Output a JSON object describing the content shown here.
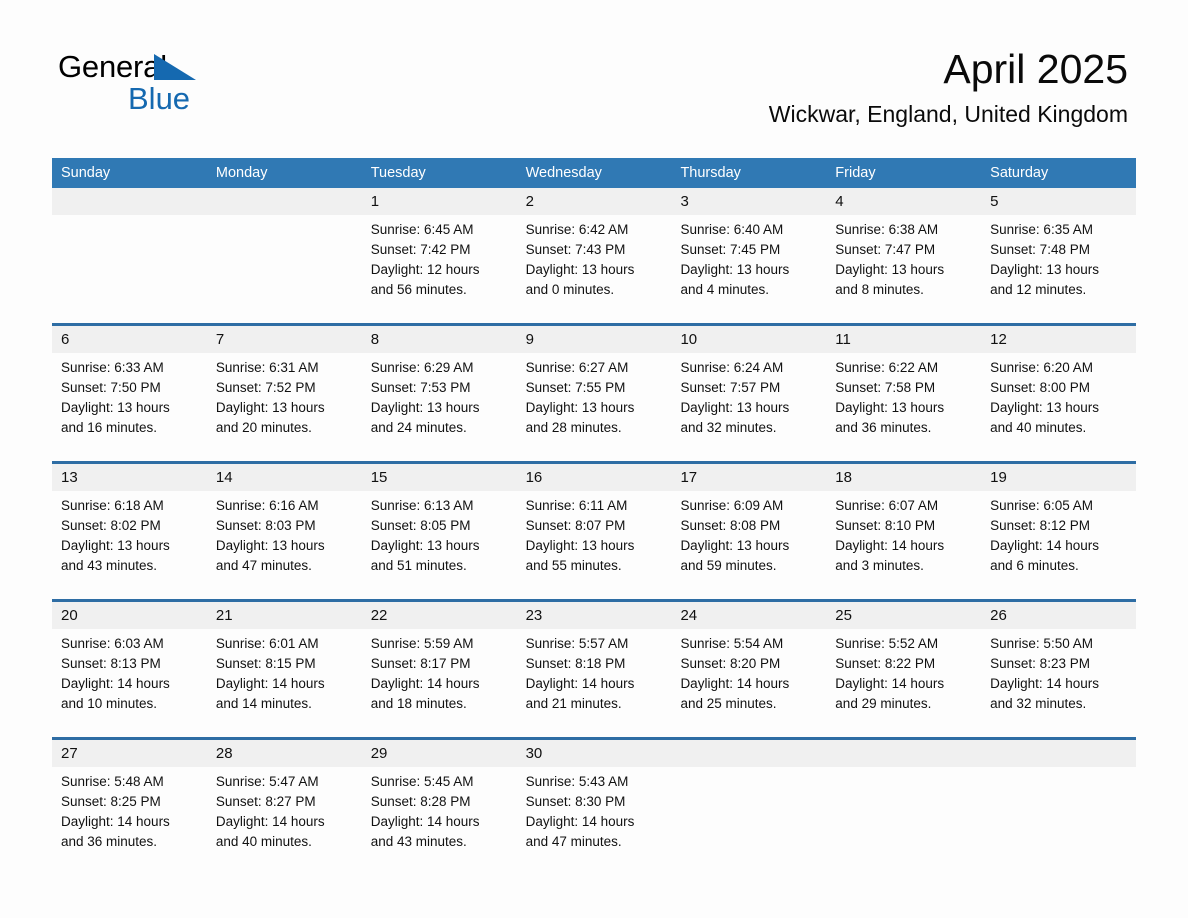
{
  "brand": {
    "name_part1": "General",
    "name_part2": "Blue",
    "primary_color": "#1569b0"
  },
  "header": {
    "title": "April 2025",
    "location": "Wickwar, England, United Kingdom"
  },
  "calendar": {
    "header_color": "#3079b4",
    "row_divider_color": "#2e6da4",
    "daynum_band_color": "#f0f0f0",
    "weekdays": [
      "Sunday",
      "Monday",
      "Tuesday",
      "Wednesday",
      "Thursday",
      "Friday",
      "Saturday"
    ],
    "weeks": [
      [
        {
          "day": "",
          "lines": []
        },
        {
          "day": "",
          "lines": []
        },
        {
          "day": "1",
          "lines": [
            "Sunrise: 6:45 AM",
            "Sunset: 7:42 PM",
            "Daylight: 12 hours",
            "and 56 minutes."
          ]
        },
        {
          "day": "2",
          "lines": [
            "Sunrise: 6:42 AM",
            "Sunset: 7:43 PM",
            "Daylight: 13 hours",
            "and 0 minutes."
          ]
        },
        {
          "day": "3",
          "lines": [
            "Sunrise: 6:40 AM",
            "Sunset: 7:45 PM",
            "Daylight: 13 hours",
            "and 4 minutes."
          ]
        },
        {
          "day": "4",
          "lines": [
            "Sunrise: 6:38 AM",
            "Sunset: 7:47 PM",
            "Daylight: 13 hours",
            "and 8 minutes."
          ]
        },
        {
          "day": "5",
          "lines": [
            "Sunrise: 6:35 AM",
            "Sunset: 7:48 PM",
            "Daylight: 13 hours",
            "and 12 minutes."
          ]
        }
      ],
      [
        {
          "day": "6",
          "lines": [
            "Sunrise: 6:33 AM",
            "Sunset: 7:50 PM",
            "Daylight: 13 hours",
            "and 16 minutes."
          ]
        },
        {
          "day": "7",
          "lines": [
            "Sunrise: 6:31 AM",
            "Sunset: 7:52 PM",
            "Daylight: 13 hours",
            "and 20 minutes."
          ]
        },
        {
          "day": "8",
          "lines": [
            "Sunrise: 6:29 AM",
            "Sunset: 7:53 PM",
            "Daylight: 13 hours",
            "and 24 minutes."
          ]
        },
        {
          "day": "9",
          "lines": [
            "Sunrise: 6:27 AM",
            "Sunset: 7:55 PM",
            "Daylight: 13 hours",
            "and 28 minutes."
          ]
        },
        {
          "day": "10",
          "lines": [
            "Sunrise: 6:24 AM",
            "Sunset: 7:57 PM",
            "Daylight: 13 hours",
            "and 32 minutes."
          ]
        },
        {
          "day": "11",
          "lines": [
            "Sunrise: 6:22 AM",
            "Sunset: 7:58 PM",
            "Daylight: 13 hours",
            "and 36 minutes."
          ]
        },
        {
          "day": "12",
          "lines": [
            "Sunrise: 6:20 AM",
            "Sunset: 8:00 PM",
            "Daylight: 13 hours",
            "and 40 minutes."
          ]
        }
      ],
      [
        {
          "day": "13",
          "lines": [
            "Sunrise: 6:18 AM",
            "Sunset: 8:02 PM",
            "Daylight: 13 hours",
            "and 43 minutes."
          ]
        },
        {
          "day": "14",
          "lines": [
            "Sunrise: 6:16 AM",
            "Sunset: 8:03 PM",
            "Daylight: 13 hours",
            "and 47 minutes."
          ]
        },
        {
          "day": "15",
          "lines": [
            "Sunrise: 6:13 AM",
            "Sunset: 8:05 PM",
            "Daylight: 13 hours",
            "and 51 minutes."
          ]
        },
        {
          "day": "16",
          "lines": [
            "Sunrise: 6:11 AM",
            "Sunset: 8:07 PM",
            "Daylight: 13 hours",
            "and 55 minutes."
          ]
        },
        {
          "day": "17",
          "lines": [
            "Sunrise: 6:09 AM",
            "Sunset: 8:08 PM",
            "Daylight: 13 hours",
            "and 59 minutes."
          ]
        },
        {
          "day": "18",
          "lines": [
            "Sunrise: 6:07 AM",
            "Sunset: 8:10 PM",
            "Daylight: 14 hours",
            "and 3 minutes."
          ]
        },
        {
          "day": "19",
          "lines": [
            "Sunrise: 6:05 AM",
            "Sunset: 8:12 PM",
            "Daylight: 14 hours",
            "and 6 minutes."
          ]
        }
      ],
      [
        {
          "day": "20",
          "lines": [
            "Sunrise: 6:03 AM",
            "Sunset: 8:13 PM",
            "Daylight: 14 hours",
            "and 10 minutes."
          ]
        },
        {
          "day": "21",
          "lines": [
            "Sunrise: 6:01 AM",
            "Sunset: 8:15 PM",
            "Daylight: 14 hours",
            "and 14 minutes."
          ]
        },
        {
          "day": "22",
          "lines": [
            "Sunrise: 5:59 AM",
            "Sunset: 8:17 PM",
            "Daylight: 14 hours",
            "and 18 minutes."
          ]
        },
        {
          "day": "23",
          "lines": [
            "Sunrise: 5:57 AM",
            "Sunset: 8:18 PM",
            "Daylight: 14 hours",
            "and 21 minutes."
          ]
        },
        {
          "day": "24",
          "lines": [
            "Sunrise: 5:54 AM",
            "Sunset: 8:20 PM",
            "Daylight: 14 hours",
            "and 25 minutes."
          ]
        },
        {
          "day": "25",
          "lines": [
            "Sunrise: 5:52 AM",
            "Sunset: 8:22 PM",
            "Daylight: 14 hours",
            "and 29 minutes."
          ]
        },
        {
          "day": "26",
          "lines": [
            "Sunrise: 5:50 AM",
            "Sunset: 8:23 PM",
            "Daylight: 14 hours",
            "and 32 minutes."
          ]
        }
      ],
      [
        {
          "day": "27",
          "lines": [
            "Sunrise: 5:48 AM",
            "Sunset: 8:25 PM",
            "Daylight: 14 hours",
            "and 36 minutes."
          ]
        },
        {
          "day": "28",
          "lines": [
            "Sunrise: 5:47 AM",
            "Sunset: 8:27 PM",
            "Daylight: 14 hours",
            "and 40 minutes."
          ]
        },
        {
          "day": "29",
          "lines": [
            "Sunrise: 5:45 AM",
            "Sunset: 8:28 PM",
            "Daylight: 14 hours",
            "and 43 minutes."
          ]
        },
        {
          "day": "30",
          "lines": [
            "Sunrise: 5:43 AM",
            "Sunset: 8:30 PM",
            "Daylight: 14 hours",
            "and 47 minutes."
          ]
        },
        {
          "day": "",
          "lines": []
        },
        {
          "day": "",
          "lines": []
        },
        {
          "day": "",
          "lines": []
        }
      ]
    ]
  }
}
